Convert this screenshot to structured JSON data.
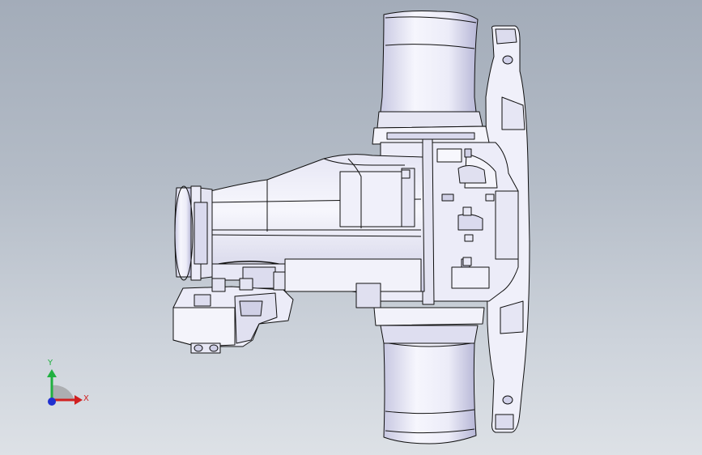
{
  "triad": {
    "x_label": "X",
    "y_label": "Y",
    "colors": {
      "x_axis": "#d02020",
      "y_axis": "#20b040",
      "z_axis": "#2030d0"
    }
  },
  "colors": {
    "background_top": "#a3acb9",
    "background_bottom": "#dde1e6",
    "part_fill": "#f2f2fb",
    "part_shade": "#cfcfe6",
    "part_deep": "#a8a8c8",
    "edge": "#101010"
  }
}
